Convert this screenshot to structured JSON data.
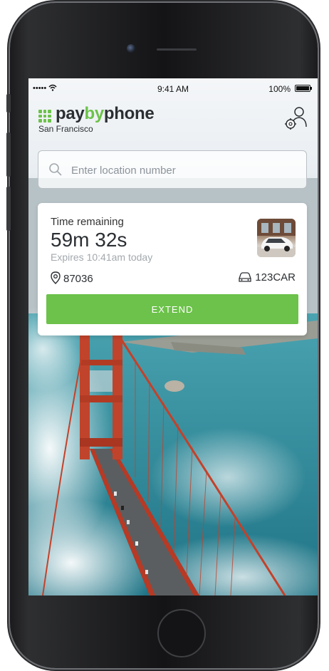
{
  "status_bar": {
    "signal": "•••••",
    "time": "9:41 AM",
    "battery": "100%"
  },
  "header": {
    "brand_pay": "pay",
    "brand_by": "by",
    "brand_phone": "phone",
    "city": "San Francisco",
    "settings_icon": "user-gear-icon"
  },
  "search": {
    "placeholder": "Enter location number",
    "value": ""
  },
  "session": {
    "label": "Time remaining",
    "time_remaining": "59m 32s",
    "expires": "Expires 10:41am today",
    "location": "87036",
    "plate": "123CAR",
    "extend_label": "EXTEND"
  },
  "colors": {
    "brand_green": "#6cc24a",
    "text_dark": "#2b2f33"
  }
}
